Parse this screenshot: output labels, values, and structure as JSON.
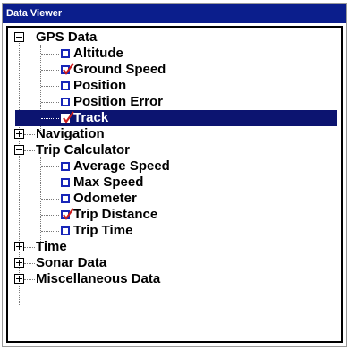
{
  "window": {
    "title": "Data Viewer"
  },
  "colors": {
    "titlebar": "#0b1e8c",
    "selection": "#0c1470",
    "checkbox": "#1826b8",
    "check": "#cc1b1b"
  },
  "tree": {
    "gps_data": {
      "label": "GPS Data",
      "expanded": true,
      "children": [
        {
          "label": "Altitude",
          "checked": false
        },
        {
          "label": "Ground Speed",
          "checked": true
        },
        {
          "label": "Position",
          "checked": false
        },
        {
          "label": "Position Error",
          "checked": false
        },
        {
          "label": "Track",
          "checked": true,
          "selected": true
        }
      ]
    },
    "navigation": {
      "label": "Navigation",
      "expanded": false
    },
    "trip_calculator": {
      "label": "Trip Calculator",
      "expanded": true,
      "children": [
        {
          "label": "Average Speed",
          "checked": false
        },
        {
          "label": "Max Speed",
          "checked": false
        },
        {
          "label": "Odometer",
          "checked": false
        },
        {
          "label": "Trip Distance",
          "checked": true
        },
        {
          "label": "Trip Time",
          "checked": false
        }
      ]
    },
    "time": {
      "label": "Time",
      "expanded": false
    },
    "sonar_data": {
      "label": "Sonar Data",
      "expanded": false
    },
    "misc_data": {
      "label": "Miscellaneous Data",
      "expanded": false
    }
  }
}
